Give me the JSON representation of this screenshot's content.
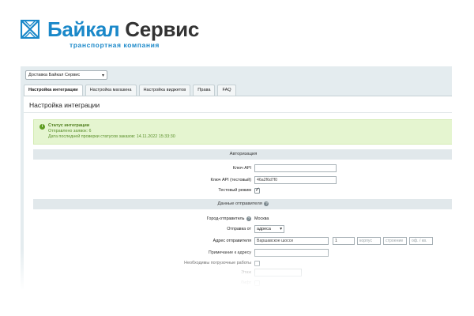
{
  "brand": {
    "name_part1": "Байкал",
    "name_part2": "Сервис",
    "tagline": "транспортная компания",
    "accent": "#1a88c9"
  },
  "site_select": {
    "value": "Доставка Байкал Сервис"
  },
  "tabs": [
    {
      "label": "Настройка интеграции",
      "active": true
    },
    {
      "label": "Настройка магазина",
      "active": false
    },
    {
      "label": "Настройка виджетов",
      "active": false
    },
    {
      "label": "Права",
      "active": false
    },
    {
      "label": "FAQ",
      "active": false
    }
  ],
  "page_title": "Настройка интеграции",
  "status": {
    "title": "Статус интеграции",
    "sent_label": "Отправлено заявок: 6",
    "last_check": "Дата последней проверки статусов заказов: 14.11.2022 15:33:30",
    "icon": "info-icon",
    "color": "#5d9c20"
  },
  "auth": {
    "heading": "Авторизация",
    "api_key_label": "Ключ API",
    "api_key_value": "",
    "api_key_test_label": "Ключ API (тестовый)",
    "api_key_test_value": "46a2f6d7f0",
    "test_mode_label": "Тестовый режим",
    "test_mode_checked": true
  },
  "sender": {
    "heading": "Данные отправителя",
    "city_label": "Город-отправитель",
    "city_value": "Москва",
    "ship_from_label": "Отправка от",
    "ship_from_value": "адреса",
    "address_label": "Адрес отправителя",
    "address_street": "Варшавское шоссе",
    "address_house": "1",
    "address_building_placeholder": "корпус",
    "address_structure_placeholder": "строение",
    "address_office_placeholder": "оф. / кв.",
    "note_label": "Примечание к адресу",
    "note_value": "",
    "loading_label": "Необходимы погрузочные работы",
    "loading_checked": false,
    "floor_label": "Этаж",
    "elevator_label": "Лифт"
  }
}
